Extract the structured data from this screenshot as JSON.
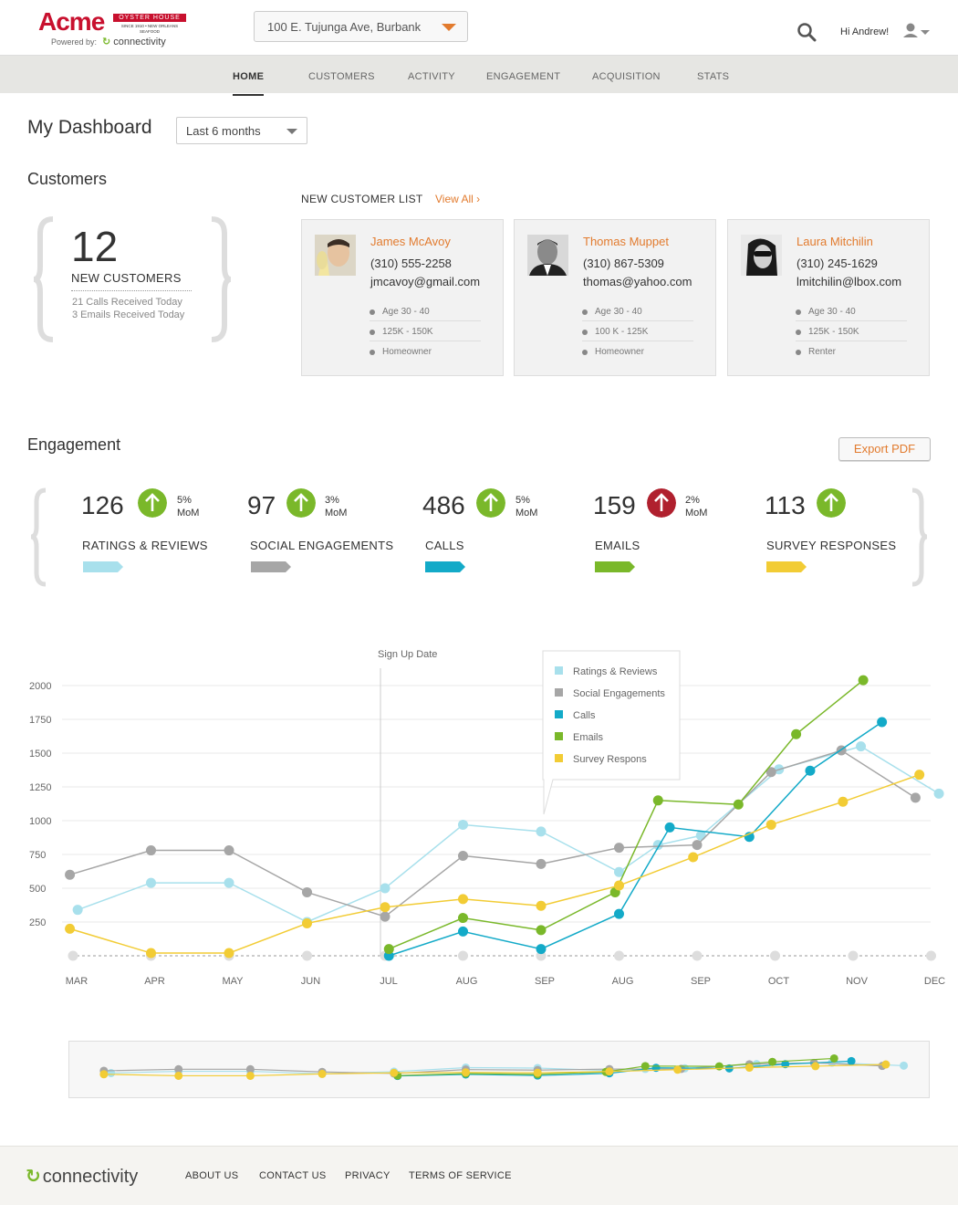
{
  "brand": {
    "name": "Acme",
    "subname": "OYSTER HOUSE",
    "tagline": "SINCE 1910 • NEW ORLEANS SEAFOOD",
    "powered_by": "Powered by:",
    "partner": "connectivity"
  },
  "header": {
    "location": "100 E. Tujunga Ave, Burbank",
    "greeting": "Hi Andrew!"
  },
  "nav": [
    "HOME",
    "CUSTOMERS",
    "ACTIVITY",
    "ENGAGEMENT",
    "ACQUISITION",
    "STATS"
  ],
  "dashboard": {
    "title": "My Dashboard",
    "range": "Last 6 months"
  },
  "customers": {
    "title": "Customers",
    "count": "12",
    "label": "NEW CUSTOMERS",
    "calls_today": "21 Calls Received Today",
    "emails_today": "3 Emails Received Today",
    "list_title": "NEW CUSTOMER LIST",
    "view_all": "View All ›",
    "cards": [
      {
        "name": "James McAvoy",
        "phone": "(310) 555-2258",
        "email": "jmcavoy@gmail.com",
        "attrs": [
          "Age 30 - 40",
          "125K - 150K",
          "Homeowner"
        ]
      },
      {
        "name": "Thomas Muppet",
        "phone": "(310) 867-5309",
        "email": "thomas@yahoo.com",
        "attrs": [
          "Age 30 - 40",
          "100 K - 125K",
          "Homeowner"
        ]
      },
      {
        "name": "Laura Mitchilin",
        "phone": "(310) 245-1629",
        "email": "lmitchilin@lbox.com",
        "attrs": [
          "Age 30 - 40",
          "125K - 150K",
          "Renter"
        ]
      }
    ]
  },
  "engagement": {
    "title": "Engagement",
    "export": "Export PDF",
    "stats": [
      {
        "value": "126",
        "pct": "5%",
        "mom": "MoM",
        "label": "RATINGS & REVIEWS",
        "color": "#a8e0ec",
        "trend": "up",
        "arrow_color": "#7ab82a"
      },
      {
        "value": "97",
        "pct": "3%",
        "mom": "MoM",
        "label": "SOCIAL ENGAGEMENTS",
        "color": "#a6a6a6",
        "trend": "up",
        "arrow_color": "#7ab82a"
      },
      {
        "value": "486",
        "pct": "5%",
        "mom": "MoM",
        "label": "CALLS",
        "color": "#13aac8",
        "trend": "up",
        "arrow_color": "#7ab82a"
      },
      {
        "value": "159",
        "pct": "2%",
        "mom": "MoM",
        "label": "EMAILS",
        "color": "#7ab82a",
        "trend": "up",
        "arrow_color": "#b0202e"
      },
      {
        "value": "113",
        "pct": "",
        "mom": "",
        "label": "SURVEY RESPONSES",
        "color": "#f2cc35",
        "trend": "up",
        "arrow_color": "#7ab82a"
      }
    ]
  },
  "chart_data": {
    "type": "line",
    "annotation": "Sign Up Date",
    "annotation_x": "JUL",
    "x": [
      "MAR",
      "APR",
      "MAY",
      "JUN",
      "JUL",
      "AUG",
      "SEP",
      "AUG",
      "SEP",
      "OCT",
      "NOV",
      "DEC"
    ],
    "yticks": [
      2000,
      1750,
      1500,
      1250,
      1000,
      750,
      500,
      250
    ],
    "ylim": [
      0,
      2000
    ],
    "legend_position": "top-center",
    "series": [
      {
        "name": "Ratings & Reviews",
        "color": "#a8e0ec",
        "points": [
          [
            0.06,
            340
          ],
          [
            1,
            540
          ],
          [
            2,
            540
          ],
          [
            3,
            250
          ],
          [
            4,
            500
          ],
          [
            5,
            970
          ],
          [
            6,
            920
          ],
          [
            7,
            620
          ],
          [
            7.5,
            820
          ],
          [
            8.05,
            890
          ],
          [
            9.05,
            1380
          ],
          [
            10.1,
            1550
          ],
          [
            11.1,
            1200
          ]
        ]
      },
      {
        "name": "Social Engagements",
        "color": "#a6a6a6",
        "points": [
          [
            -0.04,
            600
          ],
          [
            1,
            780
          ],
          [
            2,
            780
          ],
          [
            3,
            470
          ],
          [
            4,
            290
          ],
          [
            5,
            740
          ],
          [
            6,
            680
          ],
          [
            7,
            800
          ],
          [
            8,
            820
          ],
          [
            8.95,
            1360
          ],
          [
            9.85,
            1520
          ],
          [
            10.8,
            1170
          ]
        ]
      },
      {
        "name": "Calls",
        "color": "#13aac8",
        "points": [
          [
            4.05,
            0
          ],
          [
            5,
            180
          ],
          [
            6,
            50
          ],
          [
            7,
            310
          ],
          [
            7.65,
            950
          ],
          [
            8.67,
            880
          ],
          [
            9.45,
            1370
          ],
          [
            10.37,
            1730
          ]
        ]
      },
      {
        "name": "Emails",
        "color": "#7ab82a",
        "points": [
          [
            4.05,
            50
          ],
          [
            5,
            280
          ],
          [
            6,
            190
          ],
          [
            6.95,
            470
          ],
          [
            7.5,
            1150
          ],
          [
            8.53,
            1120
          ],
          [
            9.27,
            1640
          ],
          [
            10.13,
            2040
          ]
        ]
      },
      {
        "name": "Survey Respons",
        "color": "#f2cc35",
        "points": [
          [
            -0.04,
            200
          ],
          [
            1,
            20
          ],
          [
            2,
            20
          ],
          [
            3,
            240
          ],
          [
            4,
            360
          ],
          [
            5,
            420
          ],
          [
            6,
            370
          ],
          [
            7,
            520
          ],
          [
            7.95,
            730
          ],
          [
            8.95,
            970
          ],
          [
            9.87,
            1140
          ],
          [
            10.85,
            1340
          ]
        ]
      }
    ],
    "baseline_points": 12
  }
}
